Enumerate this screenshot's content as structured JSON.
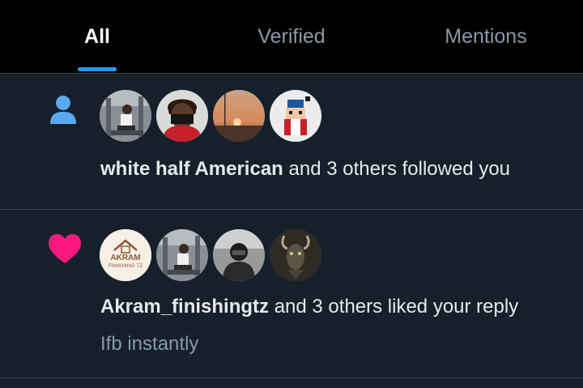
{
  "tabs": {
    "all": "All",
    "verified": "Verified",
    "mentions": "Mentions"
  },
  "notifications": [
    {
      "type": "follow",
      "icon": "person-icon",
      "icon_color": "#1d9bf0",
      "actor": "white half American",
      "action": " and 3 others followed you"
    },
    {
      "type": "like",
      "icon": "heart-icon",
      "icon_color": "#f91880",
      "actor": "Akram_finishingtz",
      "action": " and 3 others liked your reply",
      "snippet": "Ifb instantly",
      "avatar_logo_text": "AKRAM FINISHING TZ"
    }
  ],
  "colors": {
    "background": "#15202b",
    "header": "#000000",
    "accent": "#1d9bf0",
    "like": "#f91880"
  }
}
